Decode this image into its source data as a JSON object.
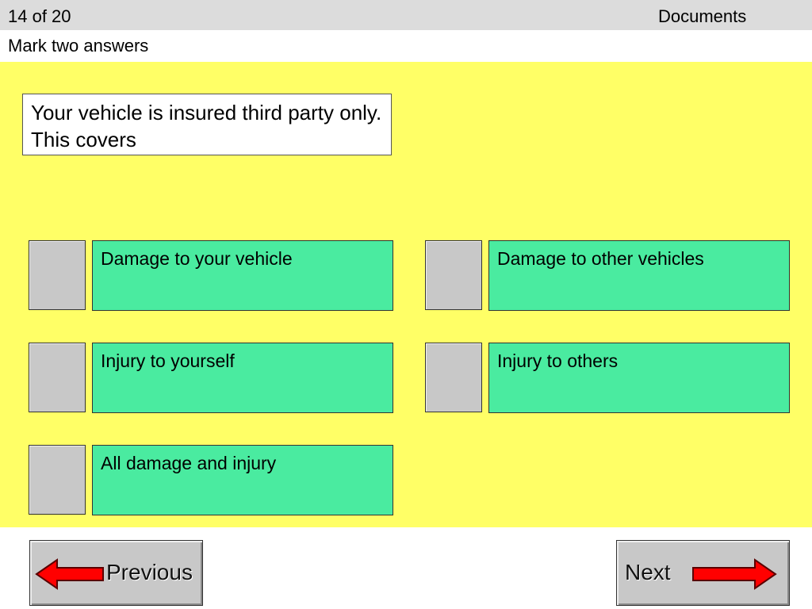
{
  "header": {
    "counter": "14 of 20",
    "category": "Documents"
  },
  "instruction": "Mark two answers",
  "question": "Your vehicle is insured third party only.  This covers",
  "answers": [
    {
      "label": "Damage to your vehicle",
      "checked": false
    },
    {
      "label": "Damage to other vehicles",
      "checked": false
    },
    {
      "label": "Injury to yourself",
      "checked": false
    },
    {
      "label": "Injury to others",
      "checked": false
    },
    {
      "label": "All damage and injury",
      "checked": false
    }
  ],
  "navigation": {
    "previous_label": "Previous",
    "next_label": "Next"
  },
  "colors": {
    "quiz_background": "#ffff66",
    "answer_background": "#4aeba0",
    "checkbox_background": "#c8c8c8",
    "arrow_fill": "#ff0000",
    "header_background": "#dcdcdc"
  },
  "icons": {
    "previous": "left-arrow-icon",
    "next": "right-arrow-icon"
  }
}
